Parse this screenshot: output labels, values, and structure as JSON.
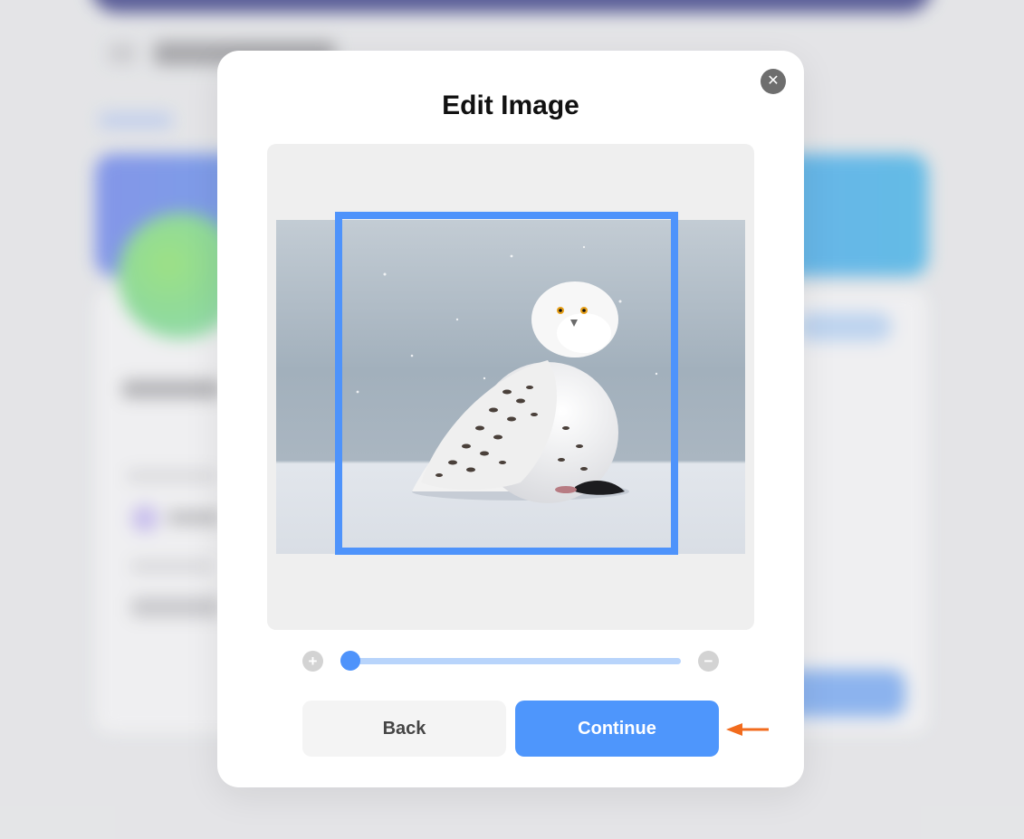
{
  "modal": {
    "title": "Edit Image",
    "close_icon": "close-icon",
    "image": {
      "subject": "snowy owl on snow",
      "colors": {
        "sky": "#a9b8c4",
        "snow": "#dde3ea",
        "frame": "#4e93fb"
      }
    },
    "zoom": {
      "zoom_in_icon": "plus-icon",
      "zoom_out_icon": "minus-icon",
      "level": 0.03
    },
    "buttons": {
      "back_label": "Back",
      "continue_label": "Continue"
    }
  },
  "annotation": {
    "arrow_icon": "arrow-left-icon",
    "color": "#f26b1d"
  },
  "colors": {
    "accent": "#4e93fb",
    "accent_light": "#b8d4fb"
  }
}
